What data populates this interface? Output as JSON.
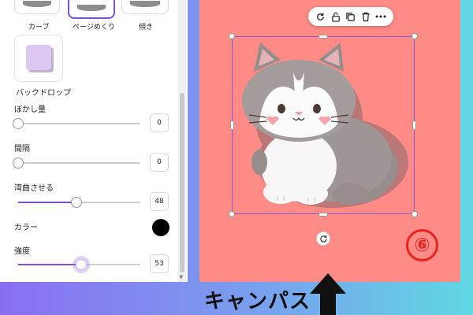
{
  "effects_panel": {
    "shape_tiles": [
      {
        "label": "カーブ"
      },
      {
        "label": "ページめくり"
      },
      {
        "label": "傾き"
      }
    ],
    "backdrop_label": "バックドロップ",
    "settings": {
      "blur": {
        "label": "ぼかし量",
        "value": "0"
      },
      "spacing": {
        "label": "間隔",
        "value": "0"
      },
      "curve": {
        "label": "湾曲させる",
        "value": "48"
      },
      "color": {
        "label": "カラー",
        "swatch": "#000000"
      },
      "intensity": {
        "label": "強度",
        "value": "53"
      }
    }
  },
  "canvas": {
    "background_color": "#ff8b87",
    "toolbar_icons": [
      "refresh-icon",
      "lock-icon",
      "duplicate-icon",
      "trash-icon",
      "more-icon"
    ],
    "step_badge": "⑥"
  },
  "caption": "キャンパス",
  "colors": {
    "accent": "#7d4fd6",
    "selection": "#8b54d9",
    "step_red": "#e8221f"
  }
}
